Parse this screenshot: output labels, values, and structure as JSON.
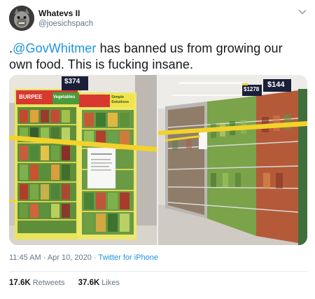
{
  "user": {
    "display_name": "Whatevs II",
    "handle": "@joesichspach"
  },
  "tweet": {
    "text_prefix": ".",
    "mention": "@GovWhitmer",
    "text_rest": " has banned us from growing our own food. This is fucking insane."
  },
  "photos": {
    "left": {
      "price_tag": "$374",
      "brand": "BURPEE",
      "category": "Vegetables",
      "sign": "Simple Solutions"
    },
    "right": {
      "price_tag_1": "$144",
      "price_tag_2": "$1278"
    }
  },
  "meta": {
    "timestamp": "11:45 AM · Apr 10, 2020 · ",
    "source": "Twitter for iPhone"
  },
  "stats": {
    "retweets_count": "17.6K",
    "retweets_label": "Retweets",
    "likes_count": "37.6K",
    "likes_label": "Likes"
  },
  "colors": {
    "link": "#1b95e0",
    "caution_tape": "#f2d22b",
    "shelf_green": "#7ab648"
  }
}
